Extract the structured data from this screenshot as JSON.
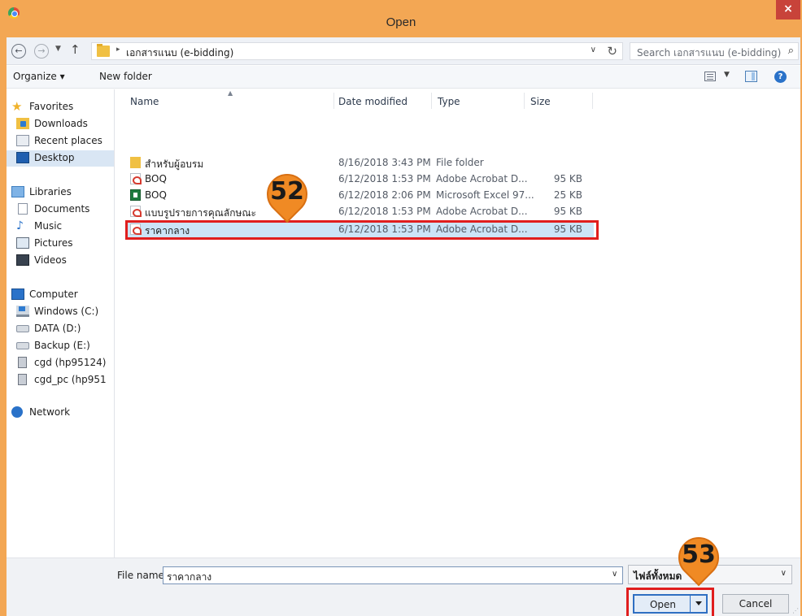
{
  "window": {
    "title": "Open",
    "close_label": "×"
  },
  "address": {
    "back_glyph": "←",
    "forward_glyph": "→",
    "dropdown_glyph": "▼",
    "up_glyph": "↑",
    "separator_glyph": "▸",
    "path": "เอกสารแนบ (e-bidding)",
    "history_glyph": "∨",
    "refresh_glyph": "↻"
  },
  "search": {
    "placeholder": "Search เอกสารแนบ (e-bidding)",
    "icon": "search-icon",
    "icon_glyph": "⌕"
  },
  "toolbar": {
    "organize_label": "Organize ▾",
    "new_folder_label": "New folder",
    "view_dropdown_glyph": "▼",
    "help_glyph": "?"
  },
  "navigation": {
    "favorites": {
      "label": "Favorites",
      "items": [
        "Downloads",
        "Recent places",
        "Desktop"
      ]
    },
    "libraries": {
      "label": "Libraries",
      "items": [
        "Documents",
        "Music",
        "Pictures",
        "Videos"
      ]
    },
    "computer": {
      "label": "Computer",
      "items": [
        "Windows (C:)",
        "DATA (D:)",
        "Backup (E:)",
        "cgd (hp95124)",
        "cgd_pc (hp951"
      ]
    },
    "network": {
      "label": "Network"
    },
    "icons": {
      "star": "★",
      "music": "♪"
    }
  },
  "file_list": {
    "columns": {
      "name": "Name",
      "date_modified": "Date modified",
      "type": "Type",
      "size": "Size"
    },
    "sort_glyph": "▲",
    "rows": [
      {
        "name": "สำหรับผู้อบรม",
        "date": "8/16/2018 3:43 PM",
        "type": "File folder",
        "size": "",
        "icon": "folder-icon"
      },
      {
        "name": "BOQ",
        "date": "6/12/2018 1:53 PM",
        "type": "Adobe Acrobat D...",
        "size": "95 KB",
        "icon": "pdf-icon"
      },
      {
        "name": "BOQ",
        "date": "6/12/2018 2:06 PM",
        "type": "Microsoft Excel 97...",
        "size": "25 KB",
        "icon": "excel-icon"
      },
      {
        "name": "แบบรูปรายการคุณลักษณะ",
        "date": "6/12/2018 1:53 PM",
        "type": "Adobe Acrobat D...",
        "size": "95 KB",
        "icon": "pdf-icon"
      },
      {
        "name": "ราคากลาง",
        "date": "6/12/2018 1:53 PM",
        "type": "Adobe Acrobat D...",
        "size": "95 KB",
        "icon": "pdf-icon",
        "selected": true
      }
    ]
  },
  "callouts": {
    "step_select": "52",
    "step_open": "53",
    "color": "#f08a24",
    "outline_color": "#e01e1e"
  },
  "bottom": {
    "file_name_label": "File name:",
    "file_name_value": "ราคากลาง",
    "file_name_dropdown_glyph": "∨",
    "filter_value": "ไฟล์ทั้งหมด",
    "filter_dropdown_glyph": "∨",
    "open_label": "Open",
    "cancel_label": "Cancel",
    "grip_glyph": "⋰"
  },
  "colors": {
    "title_bar": "#f3a754",
    "close_button": "#c8433a",
    "selection": "#cce4f7"
  }
}
